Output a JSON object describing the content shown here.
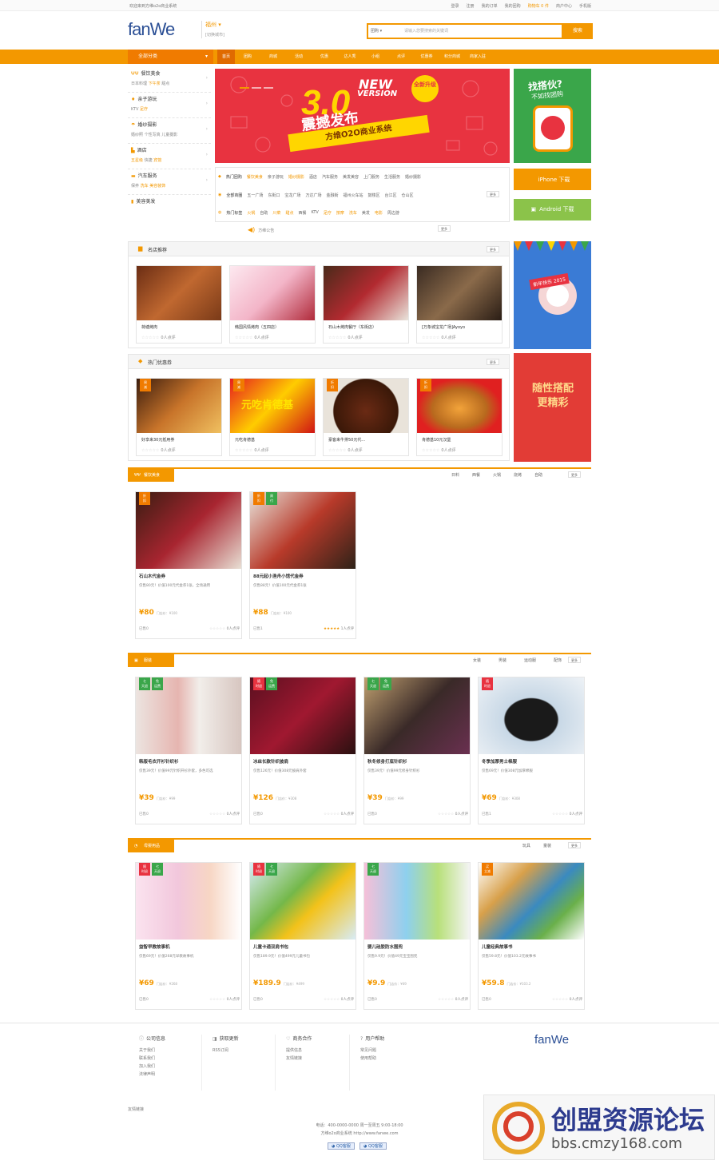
{
  "topbar": {
    "welcome": "欢迎来到方维o2o商业系统",
    "links": [
      "登录",
      "注册",
      "我的订单",
      "我的团购",
      "购物车 0 件",
      "商户中心",
      "手机版"
    ],
    "cart": "购物车 0 件"
  },
  "header": {
    "logo": "fanWe",
    "city": "福州",
    "city_switch": "[切换城市]",
    "search_cat": "团购",
    "search_placeholder": "请输入您要搜索的关键词",
    "search_btn": "搜索"
  },
  "nav": {
    "all_cat": "全部分类",
    "items": [
      "首页",
      "团购",
      "商城",
      "活动",
      "优惠",
      "达人秀",
      "小组",
      "点评",
      "优惠券",
      "积分商城",
      "商家入驻"
    ]
  },
  "side": [
    {
      "title": "餐饮美食",
      "sub": [
        "日本料理",
        "下午茶",
        "甜点"
      ],
      "hl": 1
    },
    {
      "title": "亲子游玩",
      "sub": [
        "KTV",
        "足疗"
      ],
      "hl": 1
    },
    {
      "title": "婚纱摄影",
      "sub": [
        "婚纱照",
        "个性写真",
        "儿童摄影"
      ],
      "hl": -1
    },
    {
      "title": "酒店",
      "sub": [
        "五星级",
        "快捷",
        "宾馆"
      ],
      "hl": 0
    },
    {
      "title": "汽车服务",
      "sub": [
        "保养",
        "洗车",
        "美容装饰"
      ],
      "hl": 1
    },
    {
      "title": "美容美发",
      "sub": [],
      "hl": -1
    }
  ],
  "banner": {
    "big": "3.0",
    "nv1": "NEW",
    "nv2": "VERSION",
    "headline": "震撼发布",
    "badge": "全新升级",
    "ribbon": "方维O2O商业系统"
  },
  "quick": {
    "row1": [
      "热门团购",
      "餐饮美食",
      "亲子游玩",
      "婚纱摄影",
      "酒店",
      "汽车服务",
      "美发美容",
      "上门服务",
      "生活服务",
      "婚纱摄影"
    ],
    "row2": [
      "全部商圈",
      "五一广场",
      "东街口",
      "宝龙广场",
      "万达广场",
      "金融街",
      "福州火车站",
      "鼓楼区",
      "台江区",
      "仓山区"
    ],
    "row3": [
      "热门标签",
      "火锅",
      "自助",
      "川菜",
      "甜点",
      "西餐",
      "KTV",
      "足疗",
      "按摩",
      "洗车",
      "美发",
      "电影",
      "周边游"
    ],
    "more": "更多"
  },
  "notice": "方维公告",
  "right": {
    "promo_title": "找搭伙?",
    "promo_sub": "不如找团购",
    "iphone": "iPhone 下载",
    "android": "Android 下载",
    "ny": "新年快乐 2015",
    "xmas": "随性搭配 更精彩"
  },
  "shops": {
    "title": "名店推荐",
    "more": "更多",
    "items": [
      {
        "name": "荷塘烤肉",
        "rev": "0人点评"
      },
      {
        "name": "韩国风情烤肉（五四店）",
        "rev": "0人点评"
      },
      {
        "name": "石山木烤肉餐厅（东街店）",
        "rev": "0人点评"
      },
      {
        "name": "[万象城宝龙广场]Ayoyo",
        "rev": "0人点评"
      }
    ]
  },
  "coupons": {
    "title": "热门优惠券",
    "more": "更多",
    "items": [
      {
        "name": "好享来30元抵用券",
        "rev": "0人点评"
      },
      {
        "name": "元吃肯德基",
        "rev": "0人点评"
      },
      {
        "name": "豪客来牛排50元代...",
        "rev": "0人点评"
      },
      {
        "name": "肯德基10元汉堡",
        "rev": "0人点评"
      }
    ]
  },
  "sec_food": {
    "label": "餐饮美食",
    "subs": [
      "日料",
      "西餐",
      "火锅",
      "烧烤",
      "自助"
    ],
    "more": "更多",
    "deals": [
      {
        "name": "石山木代金券",
        "desc": "仅售80元！价值100元代金券1张，全场通用",
        "price": "¥80",
        "orig": "门店价：¥100",
        "sold": "已售0",
        "rev": "0人点评"
      },
      {
        "name": "88元起小渔舟小馆代金券",
        "desc": "仅售88元！价值100元代金券1张",
        "price": "¥88",
        "orig": "门店价：¥100",
        "sold": "已售1",
        "rev": "1人点评"
      }
    ]
  },
  "sec_cloth": {
    "label": "服装",
    "subs": [
      "女装",
      "男装",
      "运动服",
      "配饰"
    ],
    "more": "更多",
    "deals": [
      {
        "name": "韩版毛衣开衫针织衫",
        "desc": "仅售39元！价值99元针织开衫外套，多色可选",
        "price": "¥39",
        "orig": "门店价：¥99",
        "sold": "已售0",
        "rev": "0人点评"
      },
      {
        "name": "冰丝长款针织披肩",
        "desc": "仅售126元！价值308元披肩外套",
        "price": "¥126",
        "orig": "门店价：¥308",
        "sold": "已售0",
        "rev": "0人点评"
      },
      {
        "name": "秋冬修身打底针织衫",
        "desc": "仅售39元！价值99元修身针织衫",
        "price": "¥39",
        "orig": "门店价：¥99",
        "sold": "已售0",
        "rev": "0人点评"
      },
      {
        "name": "冬季加厚男士棉服",
        "desc": "仅售69元！价值308元加厚棉服",
        "price": "¥69",
        "orig": "门店价：¥308",
        "sold": "已售1",
        "rev": "0人点评"
      }
    ]
  },
  "sec_baby": {
    "label": "母婴用品",
    "subs": [
      "玩具",
      "童装"
    ],
    "more": "更多",
    "deals": [
      {
        "name": "益智早教故事机",
        "desc": "仅售69元！价值268元早教故事机",
        "price": "¥69",
        "orig": "门店价：¥268",
        "sold": "已售0",
        "rev": "0人点评"
      },
      {
        "name": "儿童卡通双肩书包",
        "desc": "仅售189.9元！价值499元儿童书包",
        "price": "¥189.9",
        "orig": "门店价：¥499",
        "sold": "已售0",
        "rev": "0人点评"
      },
      {
        "name": "婴儿硅胶防水围兜",
        "desc": "仅售9.9元！价值49元宝宝围兜",
        "price": "¥9.9",
        "orig": "门店价：¥49",
        "sold": "已售0",
        "rev": "0人点评"
      },
      {
        "name": "儿童经典故事书",
        "desc": "仅售59.8元！价值103.2元故事书",
        "price": "¥59.8",
        "orig": "门店价：¥103.2",
        "sold": "已售0",
        "rev": "0人点评"
      }
    ]
  },
  "footer": {
    "cols": [
      {
        "h": "公司信息",
        "l": [
          "关于我们",
          "联系我们",
          "加入我们",
          "法律声明"
        ]
      },
      {
        "h": "获取更新",
        "l": [
          "RSS订阅"
        ]
      },
      {
        "h": "商务合作",
        "l": [
          "提供信息",
          "友情链接"
        ]
      },
      {
        "h": "用户帮助",
        "l": [
          "常见问题",
          "使用帮助"
        ]
      }
    ],
    "logo": "fanWe",
    "friend": "友情链接",
    "copy1": "电话：400-0000-0000 周一至周五 9:00-18:00",
    "copy2": "方维o2o商业系统 http://www.fanwe.com",
    "qq1": "QQ客服",
    "qq2": "QQ客服"
  },
  "watermark": {
    "title": "创盟资源论坛",
    "url": "bbs.cmzy168.com"
  }
}
